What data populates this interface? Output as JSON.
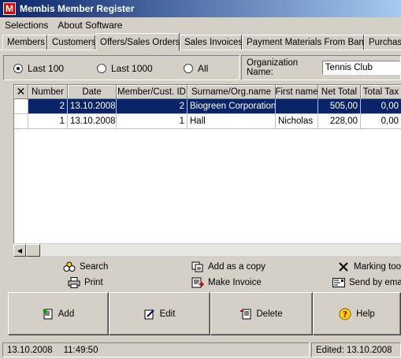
{
  "window": {
    "title": "Membis Member Register",
    "icon_letter": "M"
  },
  "menu": {
    "selections": "Selections",
    "about": "About Software"
  },
  "tabs": [
    "Members",
    "Customers",
    "Offers/Sales Orders",
    "Sales Invoices",
    "Payment Materials From Bank",
    "Purchase"
  ],
  "active_tab": "Offers/Sales Orders",
  "filter": {
    "options": [
      "Last 100",
      "Last 1000",
      "All"
    ],
    "selected": "Last 100",
    "org_label": "Organization Name:",
    "org_value": "Tennis Club"
  },
  "grid": {
    "columns": [
      "Number",
      "Date",
      "Member/Cust. ID",
      "Surname/Org.name",
      "First name",
      "Net Total",
      "Total Tax"
    ],
    "rows": [
      {
        "number": "2",
        "date": "13.10.2008",
        "member_id": "2",
        "surname": "Biogreen Corporation",
        "first_name": "",
        "net_total": "505,00",
        "total_tax": "0,00",
        "selected": true
      },
      {
        "number": "1",
        "date": "13.10.2008",
        "member_id": "1",
        "surname": "Hall",
        "first_name": "Nicholas",
        "net_total": "228,00",
        "total_tax": "0,00",
        "selected": false
      }
    ]
  },
  "actions": {
    "search": "Search",
    "print": "Print",
    "add_copy": "Add as a copy",
    "make_invoice": "Make Invoice",
    "marking_tool": "Marking tool",
    "send_email": "Send by email"
  },
  "buttons": {
    "add": "Add",
    "edit": "Edit",
    "delete": "Delete",
    "help": "Help"
  },
  "status": {
    "date": "13.10.2008",
    "time": "11:49:50",
    "edited": "Edited: 13.10.2008"
  },
  "colors": {
    "title_bar": "#0a246a",
    "selection": "#0a246a",
    "app_icon": "#d80000",
    "face": "#d4d0c8"
  }
}
